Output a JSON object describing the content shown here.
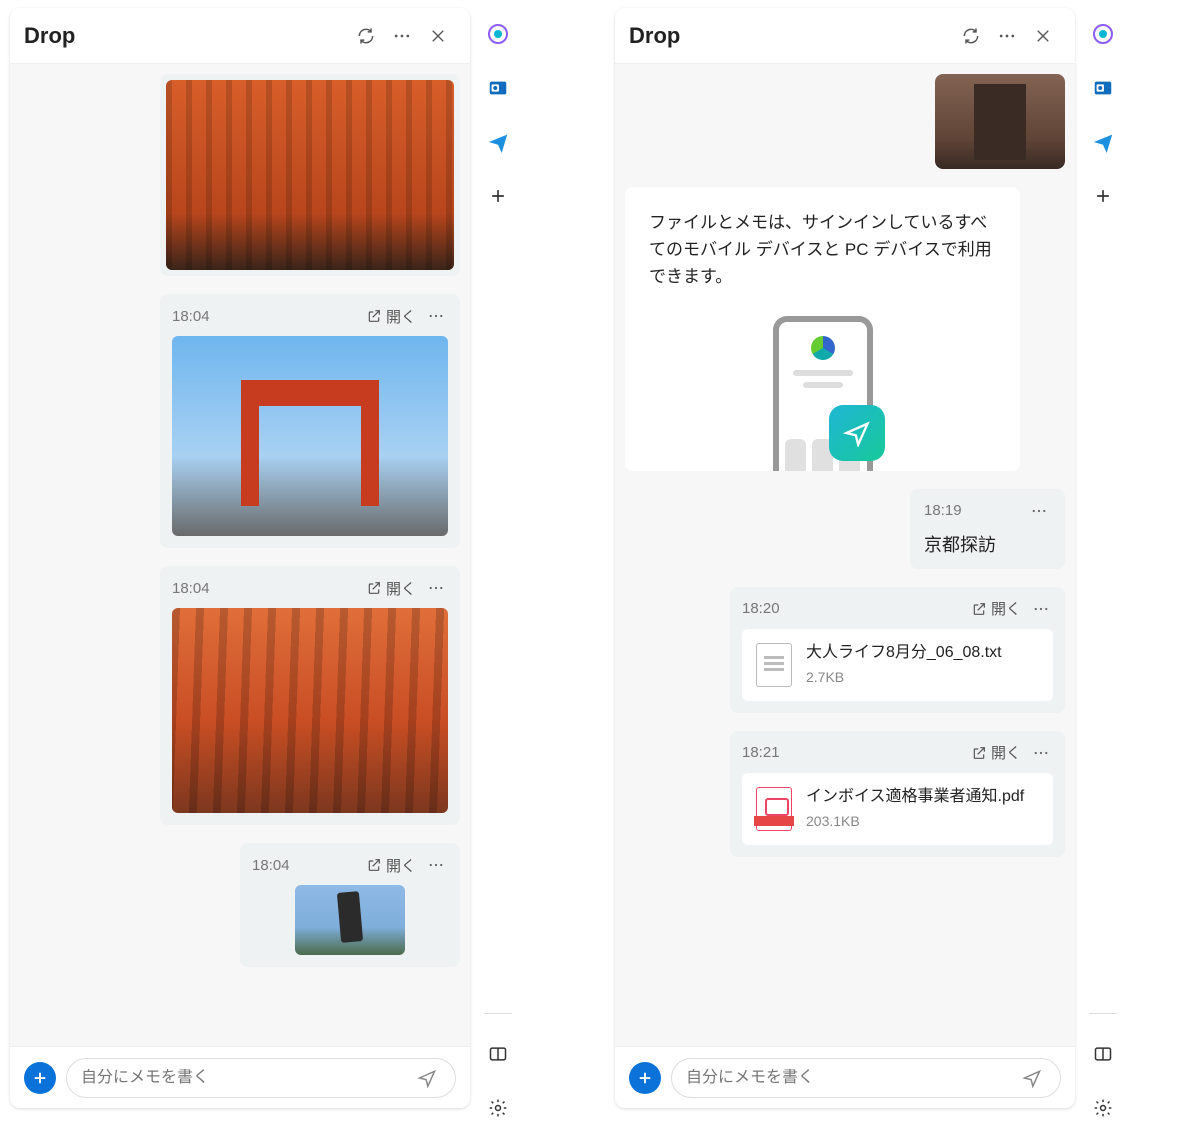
{
  "left": {
    "header": {
      "title": "Drop"
    },
    "items": [
      {
        "type": "image-card",
        "ts": null,
        "open": null,
        "image_class": "photo-torii-tunnel",
        "image_name": "photo-torii-tunnel"
      },
      {
        "type": "image-card",
        "ts": "18:04",
        "open": "開く",
        "image_class": "photo-torii-gate",
        "image_name": "photo-torii-gate"
      },
      {
        "type": "image-card",
        "ts": "18:04",
        "open": "開く",
        "image_class": "photo-torii-tunnel-2",
        "image_name": "photo-torii-path"
      },
      {
        "type": "image-card",
        "ts": "18:04",
        "open": "開く",
        "image_class": "photo-fox-statue",
        "image_name": "photo-fox-statue"
      }
    ],
    "compose_placeholder": "自分にメモを書く"
  },
  "right": {
    "header": {
      "title": "Drop"
    },
    "small_image_name": "photo-shrine-thumbnail",
    "info_text": "ファイルとメモは、サインインしているすべてのモバイル デバイスと PC デバイスで利用できます。",
    "message": {
      "ts": "18:19",
      "text": "京都探訪"
    },
    "open_label": "開く",
    "files": [
      {
        "ts": "18:20",
        "name": "大人ライフ8月分_06_08.txt",
        "size": "2.7KB",
        "kind": "txt"
      },
      {
        "ts": "18:21",
        "name": "インボイス適格事業者通知.pdf",
        "size": "203.1KB",
        "kind": "pdf"
      }
    ],
    "compose_placeholder": "自分にメモを書く"
  },
  "sidebar": {
    "icons": [
      "copilot",
      "outlook",
      "send",
      "plus"
    ]
  }
}
